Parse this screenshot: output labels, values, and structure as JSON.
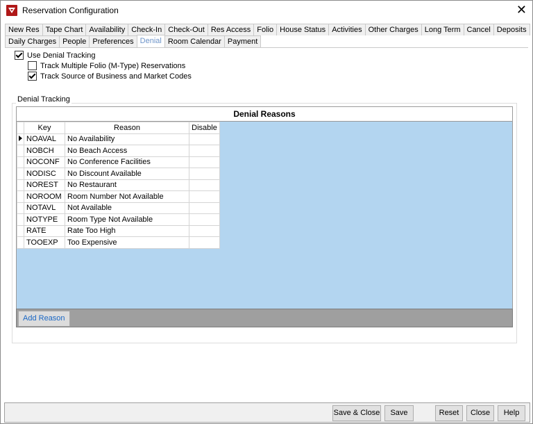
{
  "window": {
    "title": "Reservation Configuration",
    "close_glyph": "✕"
  },
  "tabs": {
    "row1": [
      "New Res",
      "Tape Chart",
      "Availability",
      "Check-In",
      "Check-Out",
      "Res Access",
      "Folio",
      "House Status",
      "Activities",
      "Other Charges",
      "Long Term",
      "Cancel",
      "Deposits"
    ],
    "row2": [
      "Daily Charges",
      "People",
      "Preferences",
      "Denial",
      "Room Calendar",
      "Payment"
    ],
    "active": "Denial"
  },
  "options": {
    "use_denial_tracking": {
      "label": "Use Denial Tracking",
      "checked": true
    },
    "track_multiple_folio": {
      "label": "Track Multiple Folio (M-Type) Reservations",
      "checked": false
    },
    "track_source": {
      "label": "Track Source of Business and Market Codes",
      "checked": true
    }
  },
  "denial_group": {
    "legend": "Denial Tracking",
    "grid_caption": "Denial Reasons",
    "columns": {
      "key": "Key",
      "reason": "Reason",
      "disable": "Disable"
    },
    "rows": [
      {
        "key": "NOAVAL",
        "reason": "No Availability",
        "disable": ""
      },
      {
        "key": "NOBCH",
        "reason": "No Beach Access",
        "disable": ""
      },
      {
        "key": "NOCONF",
        "reason": "No Conference Facilities",
        "disable": ""
      },
      {
        "key": "NODISC",
        "reason": "No Discount Available",
        "disable": ""
      },
      {
        "key": "NOREST",
        "reason": "No Restaurant",
        "disable": ""
      },
      {
        "key": "NOROOM",
        "reason": "Room Number Not Available",
        "disable": ""
      },
      {
        "key": "NOTAVL",
        "reason": "Not Available",
        "disable": ""
      },
      {
        "key": "NOTYPE",
        "reason": "Room Type Not Available",
        "disable": ""
      },
      {
        "key": "RATE",
        "reason": "Rate Too High",
        "disable": ""
      },
      {
        "key": "TOOEXP",
        "reason": "Too Expensive",
        "disable": ""
      }
    ],
    "add_reason_label": "Add Reason"
  },
  "buttons": {
    "save_close": "Save & Close",
    "save": "Save",
    "reset": "Reset",
    "close": "Close",
    "help": "Help"
  },
  "colors": {
    "grid_background": "#b3d5f0",
    "active_tab_text": "#6d94c9",
    "link_blue": "#1a67c4",
    "app_icon": "#b01818"
  }
}
